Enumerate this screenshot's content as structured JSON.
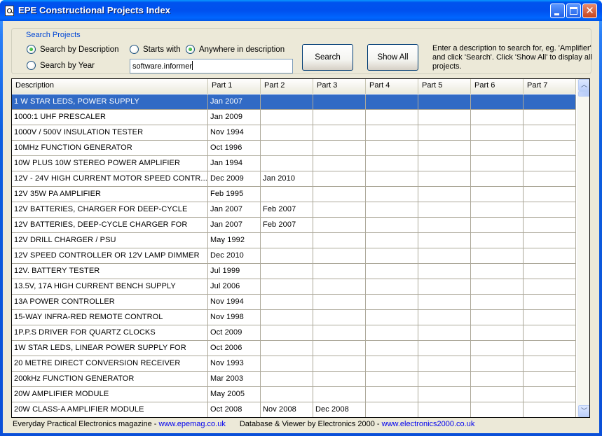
{
  "window": {
    "title": "EPE Constructional Projects Index",
    "icon": "magnifier-document-icon",
    "controls": {
      "minimize": "minimize-icon",
      "maximize": "maximize-icon",
      "close": "close-icon",
      "close_glyph": "✕"
    }
  },
  "search": {
    "group_label": "Search Projects",
    "mode_options": [
      {
        "label": "Search by Description",
        "selected": true
      },
      {
        "label": "Search by Year",
        "selected": false
      }
    ],
    "match_options": [
      {
        "label": "Starts with",
        "selected": false
      },
      {
        "label": "Anywhere in description",
        "selected": true
      }
    ],
    "query_value": "software.informer",
    "search_label": "Search",
    "show_all_label": "Show All",
    "hint": "Enter a description to search for, eg. 'Amplifier' and click 'Search'. Click 'Show All' to display all projects."
  },
  "table": {
    "columns": [
      "Description",
      "Part 1",
      "Part 2",
      "Part 3",
      "Part 4",
      "Part 5",
      "Part 6",
      "Part 7"
    ],
    "selected_row": 0,
    "rows": [
      [
        "1 W STAR LEDS, POWER SUPPLY",
        "Jan 2007",
        "",
        "",
        "",
        "",
        "",
        ""
      ],
      [
        "1000:1 UHF PRESCALER",
        "Jan 2009",
        "",
        "",
        "",
        "",
        "",
        ""
      ],
      [
        "1000V / 500V INSULATION TESTER",
        "Nov 1994",
        "",
        "",
        "",
        "",
        "",
        ""
      ],
      [
        "10MHz FUNCTION GENERATOR",
        "Oct 1996",
        "",
        "",
        "",
        "",
        "",
        ""
      ],
      [
        "10W PLUS 10W STEREO POWER AMPLIFIER",
        "Jan 1994",
        "",
        "",
        "",
        "",
        "",
        ""
      ],
      [
        "12V - 24V HIGH CURRENT MOTOR SPEED CONTR...",
        "Dec 2009",
        "Jan 2010",
        "",
        "",
        "",
        "",
        ""
      ],
      [
        "12V 35W PA AMPLIFIER",
        "Feb 1995",
        "",
        "",
        "",
        "",
        "",
        ""
      ],
      [
        "12V BATTERIES, CHARGER FOR DEEP-CYCLE",
        "Jan 2007",
        "Feb 2007",
        "",
        "",
        "",
        "",
        ""
      ],
      [
        "12V BATTERIES, DEEP-CYCLE CHARGER FOR",
        "Jan 2007",
        "Feb 2007",
        "",
        "",
        "",
        "",
        ""
      ],
      [
        "12V DRILL CHARGER / PSU",
        "May 1992",
        "",
        "",
        "",
        "",
        "",
        ""
      ],
      [
        "12V SPEED CONTROLLER OR 12V LAMP DIMMER",
        "Dec 2010",
        "",
        "",
        "",
        "",
        "",
        ""
      ],
      [
        "12V. BATTERY TESTER",
        "Jul 1999",
        "",
        "",
        "",
        "",
        "",
        ""
      ],
      [
        "13.5V, 17A HIGH CURRENT BENCH SUPPLY",
        "Jul 2006",
        "",
        "",
        "",
        "",
        "",
        ""
      ],
      [
        "13A POWER CONTROLLER",
        "Nov 1994",
        "",
        "",
        "",
        "",
        "",
        ""
      ],
      [
        "15-WAY INFRA-RED REMOTE CONTROL",
        "Nov 1998",
        "",
        "",
        "",
        "",
        "",
        ""
      ],
      [
        "1P.P.S DRIVER FOR QUARTZ CLOCKS",
        "Oct 2009",
        "",
        "",
        "",
        "",
        "",
        ""
      ],
      [
        "1W STAR LEDS, LINEAR POWER SUPPLY FOR",
        "Oct 2006",
        "",
        "",
        "",
        "",
        "",
        ""
      ],
      [
        "20 METRE DIRECT CONVERSION RECEIVER",
        "Nov 1993",
        "",
        "",
        "",
        "",
        "",
        ""
      ],
      [
        "200kHz FUNCTION GENERATOR",
        "Mar 2003",
        "",
        "",
        "",
        "",
        "",
        ""
      ],
      [
        "20W AMPLIFIER MODULE",
        "May 2005",
        "",
        "",
        "",
        "",
        "",
        ""
      ],
      [
        "20W CLASS-A AMPLIFIER MODULE",
        "Oct 2008",
        "Nov 2008",
        "Dec 2008",
        "",
        "",
        "",
        ""
      ]
    ],
    "scroll_up_glyph": "︿",
    "scroll_down_glyph": "﹀"
  },
  "footer": {
    "magazine_text": "Everyday Practical Electronics magazine - ",
    "magazine_link": "www.epemag.co.uk",
    "credit_text": "Database & Viewer by Electronics 2000 - ",
    "credit_link": "www.electronics2000.co.uk"
  }
}
